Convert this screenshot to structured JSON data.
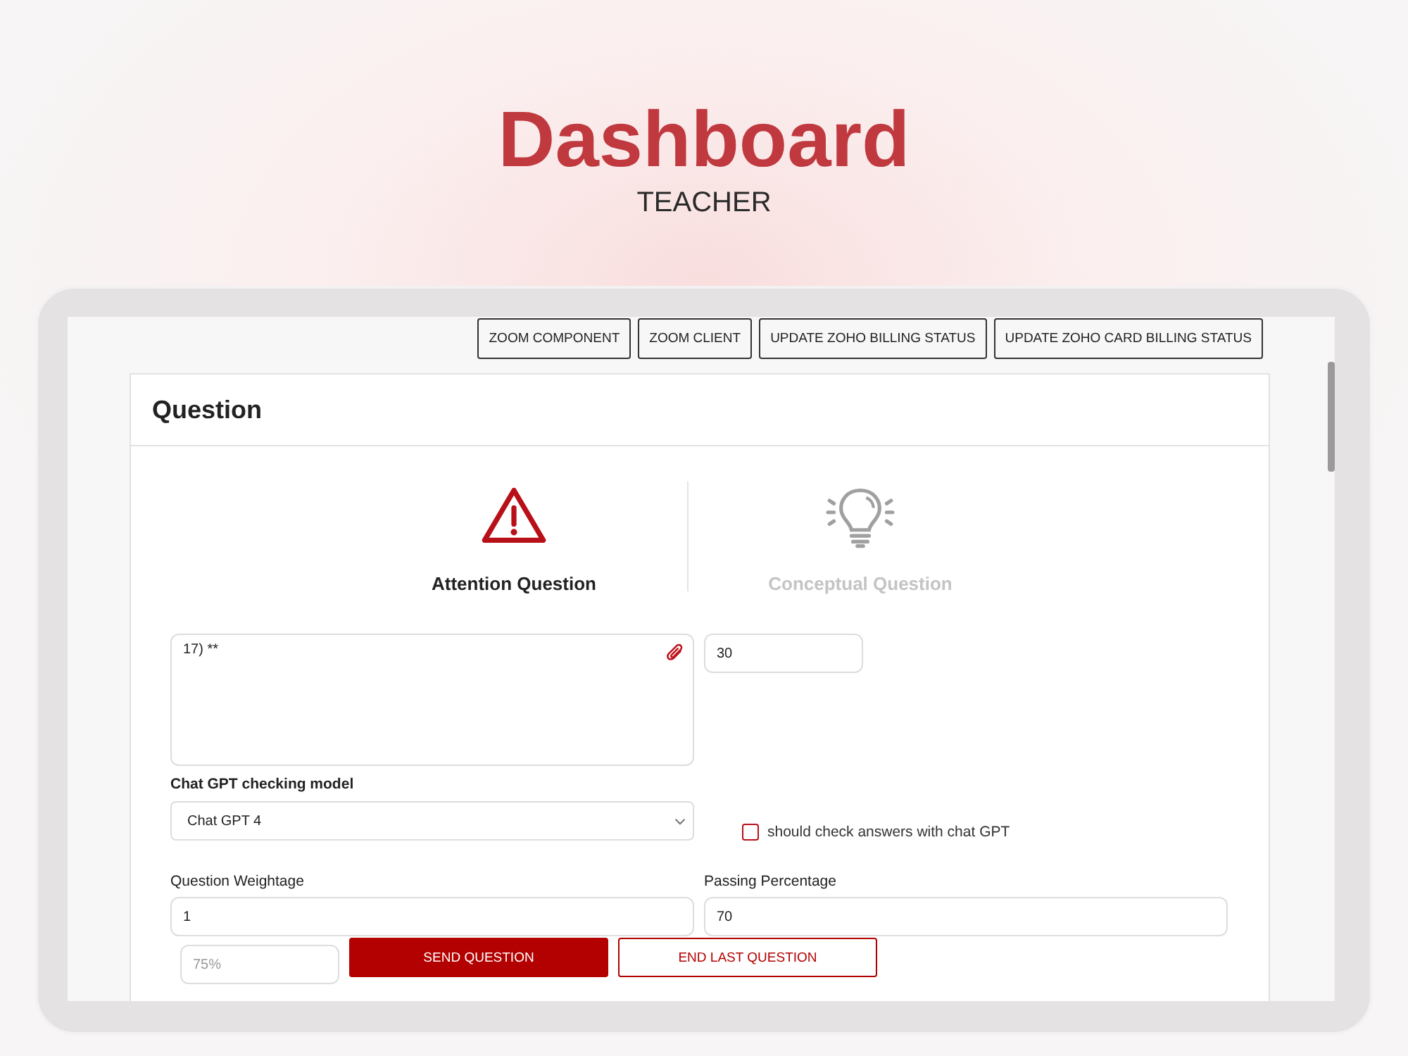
{
  "header": {
    "title": "Dashboard",
    "subtitle": "TEACHER"
  },
  "toolbar_buttons": [
    "ZOOM COMPONENT",
    "ZOOM CLIENT",
    "UPDATE ZOHO BILLING STATUS",
    "UPDATE ZOHO CARD BILLING STATUS"
  ],
  "card": {
    "title": "Question"
  },
  "question_types": [
    {
      "label": "Attention Question",
      "kind": "attention",
      "selected": true
    },
    {
      "label": "Conceptual Question",
      "kind": "conceptual",
      "selected": false
    }
  ],
  "question_text": {
    "value": "17) **"
  },
  "time_field": {
    "value": "30"
  },
  "model": {
    "label": "Chat GPT checking model",
    "value": "Chat GPT 4"
  },
  "check_with_gpt": {
    "label": "should check answers with chat GPT",
    "checked": false
  },
  "weightage": {
    "label": "Question Weightage",
    "value": "1"
  },
  "passing": {
    "label": "Passing Percentage",
    "value": "70"
  },
  "threshold": {
    "placeholder": "75%"
  },
  "actions": [
    {
      "label": "SEND QUESTION",
      "kind": "primary"
    },
    {
      "label": "END LAST QUESTION",
      "kind": "outline"
    }
  ]
}
